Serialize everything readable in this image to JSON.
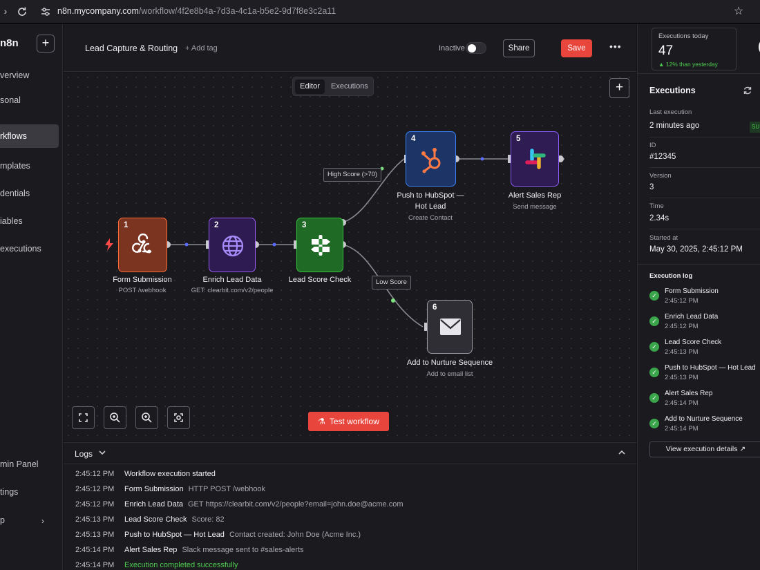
{
  "browser": {
    "url_host": "n8n.mycompany.com",
    "url_path": "/workflow/4f2e8b4a-7d3a-4c1a-b5e2-9d7f8e3c2a11"
  },
  "sidebar": {
    "logo": "n8n",
    "items": [
      {
        "label": "verview"
      },
      {
        "label": "sonal"
      },
      {
        "label": "rkflows"
      },
      {
        "label": "mplates"
      },
      {
        "label": "dentials"
      },
      {
        "label": "iables"
      },
      {
        "label": "executions"
      },
      {
        "label": "min Panel"
      },
      {
        "label": "tings"
      },
      {
        "label": "p"
      }
    ],
    "active_index": 2
  },
  "header": {
    "title": "Lead Capture & Routing",
    "add_tag": "+ Add tag",
    "status": "Inactive",
    "share": "Share",
    "save": "Save",
    "more": "•••"
  },
  "canvas": {
    "tabs": [
      "Editor",
      "Executions"
    ],
    "active_tab": "Editor",
    "test_button": "Test workflow",
    "nodes": [
      {
        "num": "1",
        "label": "Form Submission",
        "sub": "POST /webhook",
        "icon": "webhook-icon",
        "color": "#ff6d3a"
      },
      {
        "num": "2",
        "label": "Enrich Lead Data",
        "sub": "GET: clearbit.com/v2/people",
        "icon": "globe-icon",
        "color": "#9b5cf6"
      },
      {
        "num": "3",
        "label": "Lead Score Check",
        "sub": "",
        "icon": "if-icon",
        "color": "#36c43f"
      },
      {
        "num": "4",
        "label": "Push to HubSpot — Hot Lead",
        "label_line1": "Push to HubSpot —",
        "label_line2": "Hot Lead",
        "sub": "Create Contact",
        "icon": "hubspot-icon",
        "color": "#3b82f6"
      },
      {
        "num": "5",
        "label": "Alert Sales Rep",
        "sub": "Send message",
        "icon": "slack-icon",
        "color": "#8b5cf6"
      },
      {
        "num": "6",
        "label": "Add to Nurture Sequence",
        "sub": "Add to email list",
        "icon": "mail-icon",
        "color": "#9a9aa2"
      }
    ],
    "edge_labels": {
      "high": "High Score (>70)",
      "low": "Low Score"
    }
  },
  "logs": {
    "title": "Logs",
    "rows": [
      {
        "time": "2:45:12 PM",
        "name": "Workflow execution started",
        "detail": ""
      },
      {
        "time": "2:45:12 PM",
        "name": "Form Submission",
        "detail": "HTTP POST /webhook"
      },
      {
        "time": "2:45:12 PM",
        "name": "Enrich Lead Data",
        "detail": "GET https://clearbit.com/v2/people?email=john.doe@acme.com"
      },
      {
        "time": "2:45:13 PM",
        "name": "Lead Score Check",
        "detail": "Score: 82"
      },
      {
        "time": "2:45:13 PM",
        "name": "Push to HubSpot — Hot Lead",
        "detail": "Contact created: John Doe (Acme Inc.)"
      },
      {
        "time": "2:45:14 PM",
        "name": "Alert Sales Rep",
        "detail": "Slack message sent to #sales-alerts"
      },
      {
        "time": "2:45:14 PM",
        "name": "Execution completed successfully",
        "detail": ""
      }
    ]
  },
  "right_panel": {
    "stat": {
      "label": "Executions today",
      "value": "47",
      "trend": "▲ 12% than yesterday"
    },
    "title": "Executions",
    "fields": [
      {
        "label": "Last execution",
        "value": "2 minutes ago"
      },
      {
        "label": "ID",
        "value": "#12345"
      },
      {
        "label": "Version",
        "value": "3"
      },
      {
        "label": "Time",
        "value": "2.34s"
      },
      {
        "label": "Started at",
        "value": "May 30, 2025, 2:45:12 PM"
      }
    ],
    "badge": "SU",
    "log_title": "Execution log",
    "log": [
      {
        "name": "Form Submission",
        "time": "2:45:12 PM"
      },
      {
        "name": "Enrich Lead Data",
        "time": "2:45:12 PM"
      },
      {
        "name": "Lead Score Check",
        "time": "2:45:13 PM"
      },
      {
        "name": "Push to HubSpot — Hot Lead",
        "time": "2:45:13 PM"
      },
      {
        "name": "Alert Sales Rep",
        "time": "2:45:14 PM"
      },
      {
        "name": "Add to Nurture Sequence",
        "time": "2:45:14 PM"
      }
    ],
    "view_details": "View execution details"
  }
}
